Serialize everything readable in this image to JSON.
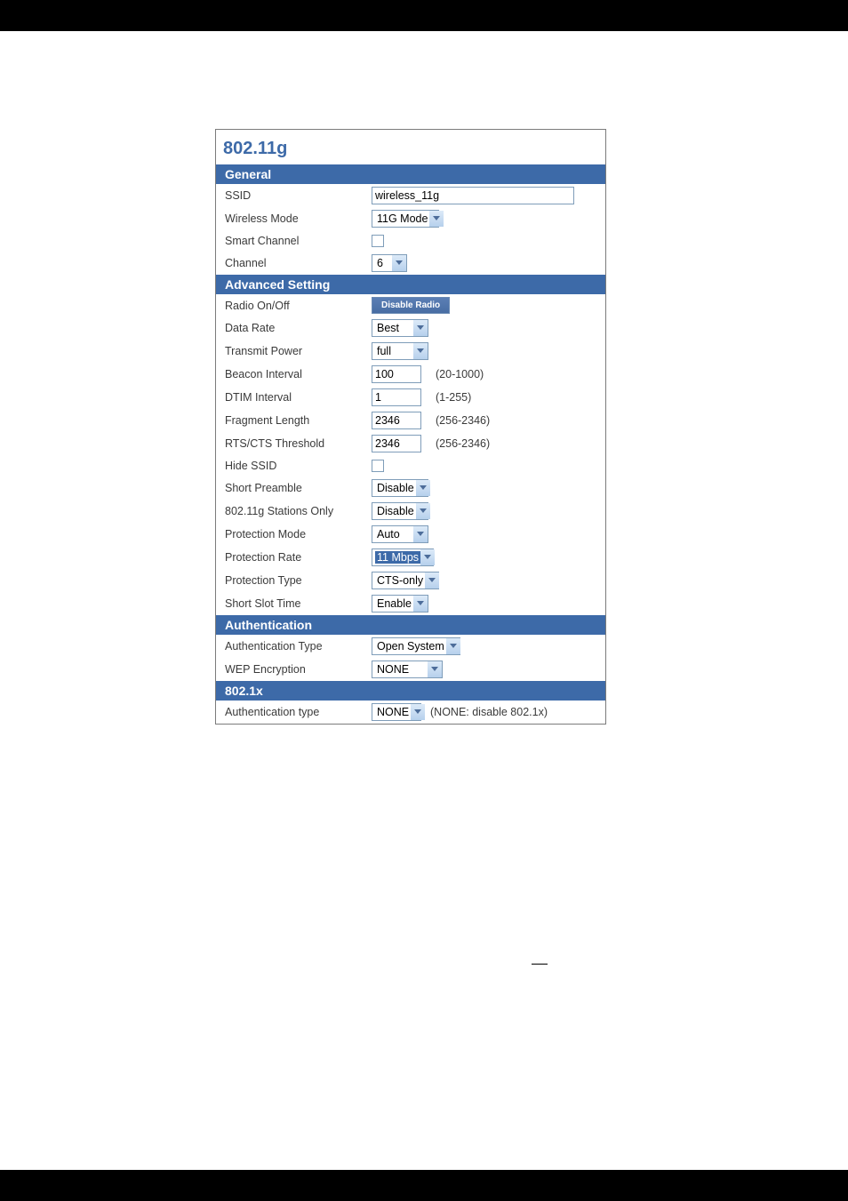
{
  "panel": {
    "title": "802.11g"
  },
  "sections": {
    "general": {
      "header": "General",
      "ssid": {
        "label": "SSID",
        "value": "wireless_11g"
      },
      "wireless_mode": {
        "label": "Wireless Mode",
        "value": "11G Mode"
      },
      "smart_channel": {
        "label": "Smart Channel",
        "checked": false
      },
      "channel": {
        "label": "Channel",
        "value": "6"
      }
    },
    "advanced": {
      "header": "Advanced Setting",
      "radio_onoff": {
        "label": "Radio On/Off",
        "button": "Disable Radio"
      },
      "data_rate": {
        "label": "Data Rate",
        "value": "Best"
      },
      "transmit_power": {
        "label": "Transmit Power",
        "value": "full"
      },
      "beacon_interval": {
        "label": "Beacon Interval",
        "value": "100",
        "hint": "(20-1000)"
      },
      "dtim_interval": {
        "label": "DTIM Interval",
        "value": "1",
        "hint": "(1-255)"
      },
      "fragment_length": {
        "label": "Fragment Length",
        "value": "2346",
        "hint": "(256-2346)"
      },
      "rts_cts_threshold": {
        "label": "RTS/CTS Threshold",
        "value": "2346",
        "hint": "(256-2346)"
      },
      "hide_ssid": {
        "label": "Hide SSID",
        "checked": false
      },
      "short_preamble": {
        "label": "Short Preamble",
        "value": "Disable"
      },
      "stations_only": {
        "label": "802.11g Stations Only",
        "value": "Disable"
      },
      "protection_mode": {
        "label": "Protection Mode",
        "value": "Auto"
      },
      "protection_rate": {
        "label": "Protection Rate",
        "value": "11 Mbps"
      },
      "protection_type": {
        "label": "Protection Type",
        "value": "CTS-only"
      },
      "short_slot_time": {
        "label": "Short Slot Time",
        "value": "Enable"
      }
    },
    "authentication": {
      "header": "Authentication",
      "auth_type": {
        "label": "Authentication Type",
        "value": "Open System"
      },
      "wep_encryption": {
        "label": "WEP Encryption",
        "value": "NONE"
      }
    },
    "eight021x": {
      "header": "802.1x",
      "auth_type": {
        "label": "Authentication type",
        "value": "NONE",
        "hint": "(NONE: disable 802.1x)"
      }
    }
  }
}
